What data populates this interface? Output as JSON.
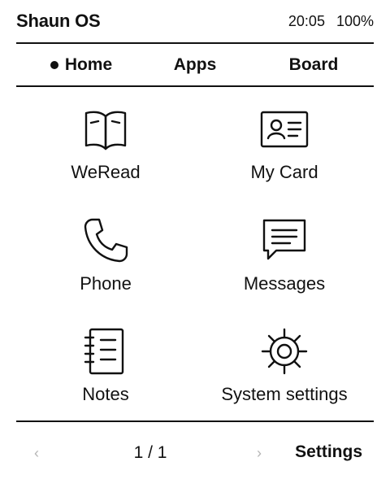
{
  "status": {
    "title": "Shaun OS",
    "time": "20:05",
    "battery": "100%"
  },
  "tabs": [
    {
      "label": "Home",
      "active": true
    },
    {
      "label": "Apps",
      "active": false
    },
    {
      "label": "Board",
      "active": false
    }
  ],
  "apps": [
    {
      "label": "WeRead",
      "icon": "open-book-icon"
    },
    {
      "label": "My Card",
      "icon": "id-card-icon"
    },
    {
      "label": "Phone",
      "icon": "phone-icon"
    },
    {
      "label": "Messages",
      "icon": "message-bubble-icon"
    },
    {
      "label": "Notes",
      "icon": "notebook-icon"
    },
    {
      "label": "System settings",
      "icon": "gear-icon"
    }
  ],
  "footer": {
    "prev": "‹",
    "page": "1 / 1",
    "next": "›",
    "settings_label": "Settings"
  },
  "colors": {
    "text": "#111111",
    "disabled": "#b5b5b5",
    "background": "#ffffff"
  }
}
